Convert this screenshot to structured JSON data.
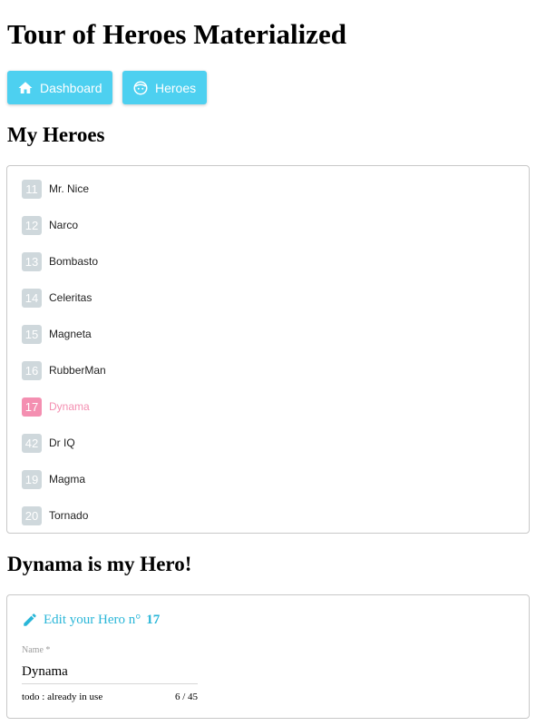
{
  "app": {
    "title": "Tour of Heroes Materialized"
  },
  "nav": {
    "dashboard": {
      "label": "Dashboard",
      "icon": "home-icon"
    },
    "heroes": {
      "label": "Heroes",
      "icon": "face-icon"
    }
  },
  "colors": {
    "accent": "#4dd0f0",
    "badge": "#cfd8dc",
    "selected": "#f48fb1",
    "edit_title": "#29b6d8"
  },
  "list": {
    "heading": "My Heroes",
    "heroes": [
      {
        "id": "11",
        "name": "Mr. Nice",
        "selected": false
      },
      {
        "id": "12",
        "name": "Narco",
        "selected": false
      },
      {
        "id": "13",
        "name": "Bombasto",
        "selected": false
      },
      {
        "id": "14",
        "name": "Celeritas",
        "selected": false
      },
      {
        "id": "15",
        "name": "Magneta",
        "selected": false
      },
      {
        "id": "16",
        "name": "RubberMan",
        "selected": false
      },
      {
        "id": "17",
        "name": "Dynama",
        "selected": true
      },
      {
        "id": "42",
        "name": "Dr IQ",
        "selected": false
      },
      {
        "id": "19",
        "name": "Magma",
        "selected": false
      },
      {
        "id": "20",
        "name": "Tornado",
        "selected": false
      }
    ]
  },
  "detail": {
    "heading": "Dynama is my Hero!",
    "edit_prefix": "Edit your Hero n°",
    "edit_number": "17",
    "edit_icon": "pencil-icon",
    "field_label": "Name *",
    "name_value": "Dynama",
    "hint": "todo : already in use",
    "counter": "6 / 45"
  }
}
